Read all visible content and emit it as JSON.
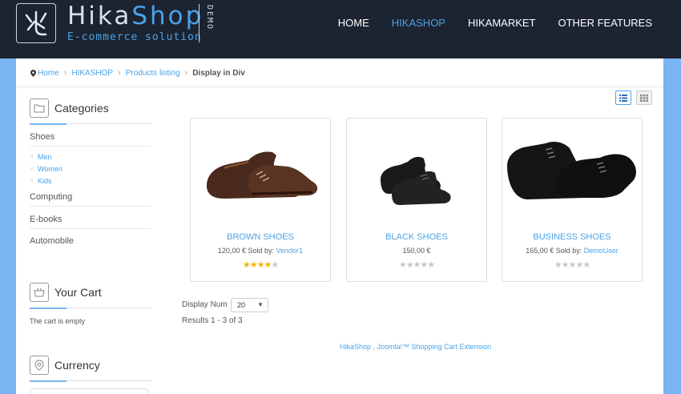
{
  "header": {
    "brand_part1": "Hika",
    "brand_part2": "Shop",
    "tagline": "E-commerce solution",
    "demo_label": "DEMO",
    "nav": [
      {
        "label": "HOME",
        "active": false
      },
      {
        "label": "HIKASHOP",
        "active": true
      },
      {
        "label": "HIKAMARKET",
        "active": false
      },
      {
        "label": "OTHER FEATURES",
        "active": false
      }
    ]
  },
  "breadcrumb": {
    "items": [
      "Home",
      "HIKASHOP",
      "Products listing"
    ],
    "current": "Display in Div"
  },
  "sidebar": {
    "categories_title": "Categories",
    "categories": [
      "Shoes",
      "Computing",
      "E-books",
      "Automobile"
    ],
    "subcategories": [
      "Men",
      "Women",
      "Kids"
    ],
    "cart_title": "Your Cart",
    "cart_status": "The cart is empty",
    "currency_title": "Currency"
  },
  "products": [
    {
      "name": "BROWN SHOES",
      "price": "120,00 €",
      "sold_by_label": "Sold by:",
      "vendor": "Vendor1",
      "rating": 4,
      "max_rating": 5,
      "color": "#4a2a1c"
    },
    {
      "name": "BLACK SHOES",
      "price": "150,00 €",
      "sold_by_label": "",
      "vendor": "",
      "rating": 0,
      "max_rating": 5,
      "color": "#1a1a1a"
    },
    {
      "name": "BUSINESS SHOES",
      "price": "165,00 €",
      "sold_by_label": "Sold by:",
      "vendor": "DemoUser",
      "rating": 0,
      "max_rating": 5,
      "color": "#151515"
    }
  ],
  "listing": {
    "display_num_label": "Display Num",
    "display_num_value": "20",
    "results": "Results 1 - 3 of 3"
  },
  "footer": {
    "link": "HikaShop , Joomla!™ Shopping Cart Extension"
  },
  "colors": {
    "accent": "#4aa3e8",
    "header_bg": "#1c2331",
    "page_bg": "#7ab4f2",
    "star": "#f4b400"
  }
}
